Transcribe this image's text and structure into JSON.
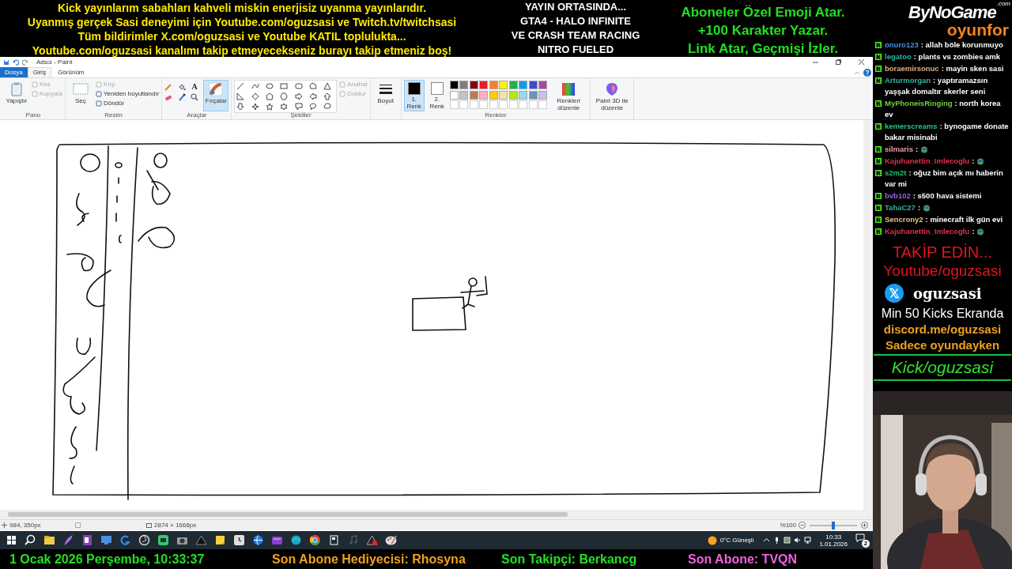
{
  "top_banner": {
    "left_lines": [
      "Kick yayınlarım sabahları kahveli miskin enerjisiz uyanma yayınlarıdır.",
      "Uyanmış gerçek Sasi deneyimi için Youtube.com/oguzsasi ve Twitch.tv/twitchsasi",
      "Tüm bildirimler X.com/oguzsasi ve Youtube KATIL toplulukta...",
      "Youtube.com/oguzsasi kanalımı takip etmeyecekseniz burayı takip etmeniz boş!"
    ],
    "center_lines": [
      "YAYIN ORTASINDA...",
      "GTA4 - HALO INFINITE",
      "VE CRASH TEAM RACING",
      "NITRO FUELED"
    ],
    "right_lines": [
      "Aboneler Özel Emoji Atar.",
      "+100 Karakter Yazar.",
      "Link Atar, Geçmişi İzler."
    ]
  },
  "brand": {
    "name": "ByNoGame",
    "suffix": ".com",
    "sub": "oyunfor"
  },
  "paint": {
    "title": "Adsız - Paint",
    "tabs": [
      {
        "label": "Dosya",
        "kind": "file",
        "selected": false
      },
      {
        "label": "Giriş",
        "kind": "tab",
        "selected": true
      },
      {
        "label": "Görünüm",
        "kind": "tab",
        "selected": false
      }
    ],
    "groups": [
      {
        "label": "Pano",
        "items": [
          {
            "kind": "large",
            "label": "Yapıştır",
            "selected": false
          },
          {
            "kind": "small",
            "label": "Kes",
            "disabled": true
          },
          {
            "kind": "small",
            "label": "Kopyala",
            "disabled": true
          }
        ]
      },
      {
        "label": "Resim",
        "items": [
          {
            "kind": "large",
            "label": "Seç",
            "selected": false
          },
          {
            "kind": "small",
            "label": "Kırp",
            "disabled": true
          },
          {
            "kind": "small",
            "label": "Yeniden boyutlandır",
            "disabled": false
          },
          {
            "kind": "small",
            "label": "Döndür",
            "disabled": false
          }
        ]
      },
      {
        "label": "Araçlar",
        "items": [
          {
            "kind": "tools",
            "text_tool": "A"
          },
          {
            "kind": "large",
            "label": "Fırçalar",
            "selected": true
          }
        ]
      },
      {
        "label": "Şekiller",
        "items": [
          {
            "kind": "shapes"
          },
          {
            "kind": "small",
            "label": "Anahat",
            "disabled": true
          },
          {
            "kind": "small",
            "label": "Doldur",
            "disabled": true
          }
        ]
      },
      {
        "items": [
          {
            "kind": "large",
            "label": "Boyut",
            "selected": false
          }
        ]
      },
      {
        "label": "Renkler",
        "items": [
          {
            "kind": "color",
            "label": "1. Renk",
            "color": "#000000",
            "selected": true
          },
          {
            "kind": "color",
            "label": "2. Renk",
            "color": "#ffffff",
            "selected": false
          },
          {
            "kind": "palette",
            "colors": [
              {
                "color": "#000000"
              },
              {
                "color": "#7f7f7f"
              },
              {
                "color": "#880015"
              },
              {
                "color": "#ed1c24"
              },
              {
                "color": "#ff7f27"
              },
              {
                "color": "#fff200"
              },
              {
                "color": "#22b14c"
              },
              {
                "color": "#00a2e8"
              },
              {
                "color": "#3f48cc"
              },
              {
                "color": "#a349a4"
              },
              {
                "color": "#ffffff"
              },
              {
                "color": "#c3c3c3"
              },
              {
                "color": "#b97a57"
              },
              {
                "color": "#ffaec9"
              },
              {
                "color": "#ffc90e"
              },
              {
                "color": "#efe4b0"
              },
              {
                "color": "#b5e61d"
              },
              {
                "color": "#99d9ea"
              },
              {
                "color": "#7092be"
              },
              {
                "color": "#c8bfe7"
              }
            ]
          },
          {
            "kind": "large",
            "label": "Renkleri düzenle",
            "selected": false
          }
        ]
      },
      {
        "items": [
          {
            "kind": "large",
            "label": "Paint 3D ile düzenle",
            "selected": false
          }
        ]
      }
    ],
    "status": {
      "position": "984, 350px",
      "size": "2874 × 1668px",
      "zoom": "%100",
      "level": 0.5
    }
  },
  "taskbar": {
    "weather": "0°C Güneşli",
    "time": "10:33",
    "date": "1.01.2026",
    "notifications": "2"
  },
  "bottom_banner": [
    {
      "text": "1 Ocak 2026 Perşembe, 10:33:37",
      "color": "#22e022"
    },
    {
      "text": "Son Abone Hediyecisi: Rhosyna",
      "color": "#f0a020"
    },
    {
      "text": "Son Takipçi: Berkancg",
      "color": "#22e022"
    },
    {
      "text": "Son Abone: TVQN",
      "color": "#f060e0"
    }
  ],
  "chat": [
    {
      "user": "onuro123",
      "color": "#4a8fe0",
      "text": ": allah böle korunmuyo",
      "kind": "text"
    },
    {
      "user": "legatoo",
      "color": "#2bb5a5",
      "text": ": plants vs zombies amk",
      "kind": "text"
    },
    {
      "user": "boraemirsonuc",
      "color": "#e0b07a",
      "text": ": mayin sken sasi",
      "kind": "text"
    },
    {
      "user": "Arturmorgan",
      "color": "#30b8a0",
      "text": ": yaptıramazsın yaşşak domaltır skerler seni",
      "kind": "text"
    },
    {
      "user": "MyPhoneisRinging",
      "color": "#6bd13a",
      "text": ": north korea ev",
      "kind": "text"
    },
    {
      "user": "kemerscreams",
      "color": "#2bc080",
      "text": ": bynogame donate bakar misinabi",
      "kind": "text"
    },
    {
      "user": "silmaris",
      "color": "#e8a0a0",
      "text": ":",
      "kind": "emote"
    },
    {
      "user": "Kajuhanettin_Imlecoglu",
      "color": "#e03050",
      "text": ":",
      "kind": "emote"
    },
    {
      "user": "s2m2t",
      "color": "#20c070",
      "text": ": oğuz bim açık mı haberin var mi",
      "kind": "text"
    },
    {
      "user": "bvb102",
      "color": "#a060e0",
      "text": ": s500 hava sistemi",
      "kind": "text"
    },
    {
      "user": "TahaC27",
      "color": "#30b0a0",
      "text": ":",
      "kind": "emote"
    },
    {
      "user": "Sencrony2",
      "color": "#e8c080",
      "text": ": minecraft ilk gün evi",
      "kind": "text"
    },
    {
      "user": "Kajuhanettin_Imlecoglu",
      "color": "#e03050",
      "text": ":",
      "kind": "emote"
    }
  ],
  "follow": {
    "heading": "TAKİP EDİN...",
    "youtube": "Youtube/oguzsasi",
    "x_handle": "oguzsasi",
    "kicks": "Min 50 Kicks Ekranda",
    "discord": "discord.me/oguzsasi",
    "note": "Sadece oyundayken",
    "kick": "Kick/oguzsasi"
  }
}
